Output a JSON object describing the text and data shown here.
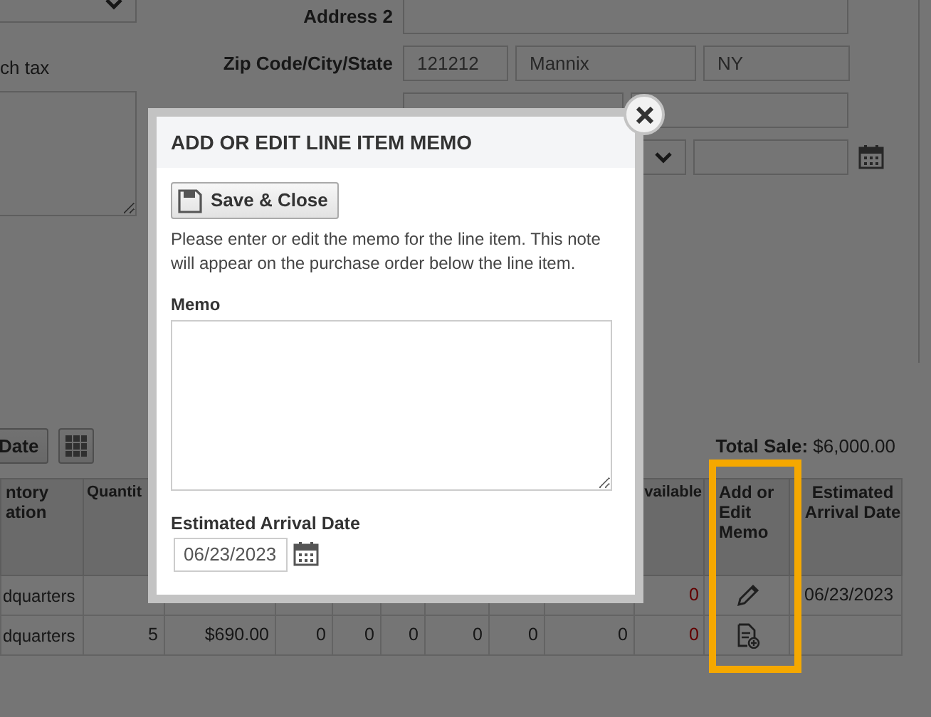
{
  "left_panel": {
    "label": "ch tax"
  },
  "form": [
    {
      "label": "Address 2",
      "fields": [
        {
          "kind": "text"
        }
      ]
    },
    {
      "label": "Zip Code/City/State",
      "fields": [
        {
          "kind": "text",
          "value": "121212"
        },
        {
          "kind": "text",
          "value": "Mannix"
        },
        {
          "kind": "text",
          "value": "NY"
        }
      ]
    },
    {
      "fields": [
        {
          "kind": "text"
        },
        {
          "kind": "text"
        }
      ]
    },
    {
      "fields": [
        {
          "kind": "select"
        },
        {
          "kind": "date"
        }
      ]
    }
  ],
  "toolbar": {
    "buttons": [
      {
        "kind": "text",
        "label": "Date"
      },
      {
        "kind": "grid"
      }
    ],
    "total_sale": "**Total Sale:** $6,000.00"
  },
  "table": {
    "columns": [
      {
        "label": "ntory ation"
      },
      {
        "label": "Quantit"
      },
      {},
      {},
      {},
      {},
      {},
      {},
      {},
      {
        "label": "vailable"
      },
      {
        "label": "Add or Edit Memo",
        "highlighted": true
      },
      {
        "label": "Estimated Arrival Date"
      }
    ],
    "rows": [
      {
        "cells": [
          "dquarters"
        ],
        "available": "0",
        "kind": "edit",
        "arrival_date": "06/23/2023"
      },
      {
        "cells": [
          "dquarters",
          "5",
          "$690.00",
          "0",
          "0",
          "0",
          "0",
          "0",
          "0"
        ],
        "available": "0",
        "kind": "add"
      }
    ]
  },
  "modal": {
    "title": "ADD OR EDIT LINE ITEM MEMO",
    "save_button": "Save & Close",
    "instructions": "Please enter or edit the memo for the line item. This note will appear on the purchase order below the line item.",
    "memo_label": "Memo",
    "date_label": "Estimated Arrival Date",
    "date_value": "06/23/2023"
  }
}
